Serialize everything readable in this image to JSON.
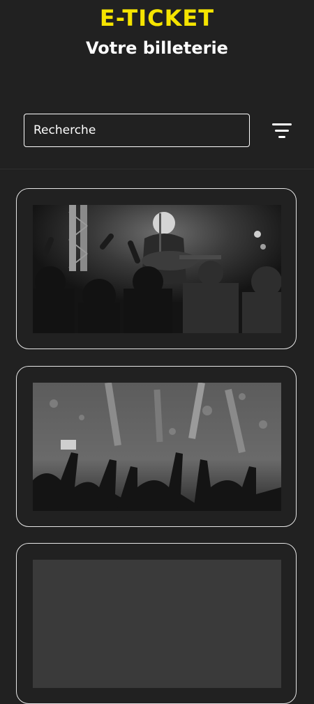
{
  "header": {
    "brand": "E-TICKET",
    "subtitle": "Votre billeterie"
  },
  "search": {
    "placeholder": "Recherche",
    "value": ""
  },
  "filter": {
    "icon": "filter-icon"
  },
  "events": [
    {
      "image": "concert-guitarist-photo"
    },
    {
      "image": "concert-crowd-lights-photo"
    },
    {
      "image": "event-photo"
    }
  ],
  "colors": {
    "background": "#212121",
    "accent": "#f5e400",
    "text": "#ffffff",
    "card_border": "#e6e6e6"
  }
}
